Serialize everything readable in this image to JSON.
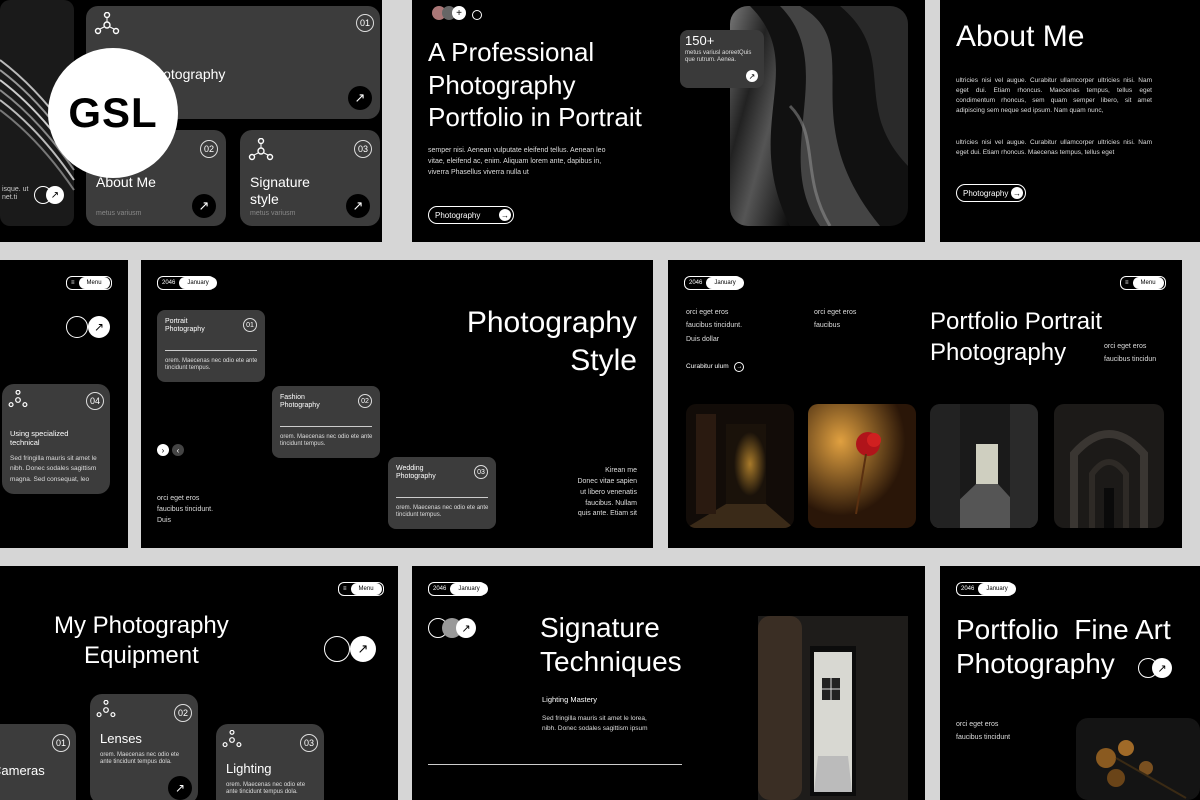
{
  "badge": {
    "text": "GSL"
  },
  "s1": {
    "card_top": {
      "num": "01",
      "label": "Photography"
    },
    "card_about": {
      "num": "02",
      "label": "About Me",
      "sub": "metus variusm"
    },
    "card_sig": {
      "num": "03",
      "label": "Signature style",
      "sub": "metus variusm"
    },
    "left_text": "isque. ut\nnet.ti"
  },
  "s2": {
    "title": "A Professional Photography Portfolio in Portrait",
    "body": "semper nisi. Aenean vulputate eleifend tellus. Aenean leo vitae, eleifend ac, enim. Aliquam lorem ante, dapibus in, viverra Phasellus viverra nulla ut",
    "stat_value": "150+",
    "stat_text": "metus variusl aoreetQuis que rutrum. Aenea.",
    "button": "Photography"
  },
  "s3": {
    "title": "About Me",
    "para1": "ultricies nisi vel augue. Curabitur ullamcorper ultricies nisi. Nam eget dui. Etiam rhoncus. Maecenas tempus, tellus eget condimentum rhoncus, sem quam semper libero, sit amet adipiscing sem neque sed ipsum. Nam quam nunc,",
    "para2": "ultricies nisi vel augue. Curabitur ullamcorper ultricies nisi. Nam eget dui. Etiam rhoncus. Maecenas tempus, tellus eget",
    "button": "Photography"
  },
  "s4": {
    "menu": "Menu",
    "card": {
      "num": "04",
      "title": "Using specialized technical",
      "text": "Sed fringilla mauris sit amet le nibh. Donec sodales sagittism magna. Sed consequat, leo"
    }
  },
  "s5": {
    "year": "2046",
    "month": "January",
    "title1": "Photography",
    "title2": "Style",
    "cards": [
      {
        "num": "01",
        "title": "Portrait Photography",
        "text": "orem. Maecenas nec odio ete ante tincidunt tempus."
      },
      {
        "num": "02",
        "title": "Fashion Photography",
        "text": "orem. Maecenas nec odio ete ante tincidunt tempus."
      },
      {
        "num": "03",
        "title": "Wedding Photography",
        "text": "orem. Maecenas nec odio ete ante tincidunt tempus."
      }
    ],
    "left_bottom": "orci eget eros\nfaucibus tincidunt.\nDuis",
    "right_bottom": "Kirean me\nDonec vitae sapien\nut libero venenatis\nfaucibus. Nullam\nquis ante. Etiam sit"
  },
  "s6": {
    "year": "2046",
    "month": "January",
    "menu": "Menu",
    "col1": "orci eget eros\nfaucibus tincidunt.\nDuis dollar",
    "col2": "orci eget eros\nfaucibus",
    "link": "Curabitur ulum",
    "title": "Portfolio Portrait Photography",
    "side": "orci eget eros\nfaucibus tincidun"
  },
  "s7": {
    "menu": "Menu",
    "title1": "My Photography",
    "title2": "Equipment",
    "cards": [
      {
        "num": "01",
        "title": "Cameras"
      },
      {
        "num": "02",
        "title": "Lenses",
        "text": "orem. Maecenas nec odio ete ante tincidunt tempus dola."
      },
      {
        "num": "03",
        "title": "Lighting",
        "text": "orem. Maecenas nec odio ete ante tincidunt tempus dola."
      }
    ]
  },
  "s8": {
    "year": "2046",
    "month": "January",
    "title1": "Signature",
    "title2": "Techniques",
    "sub": "Lighting Mastery",
    "text": "Sed fringilla mauris sit amet le lorea, nibh. Donec sodales sagittism ipsum"
  },
  "s9": {
    "year": "2046",
    "month": "January",
    "title1": "Portfolio  Fine Art",
    "title2": "Photography",
    "text": "orci eget eros\nfaucibus tincidunt"
  },
  "colors": {
    "background": "#d6d6d6",
    "slide": "#000000",
    "card": "#3c3c3c",
    "accent": "#ffffff"
  }
}
